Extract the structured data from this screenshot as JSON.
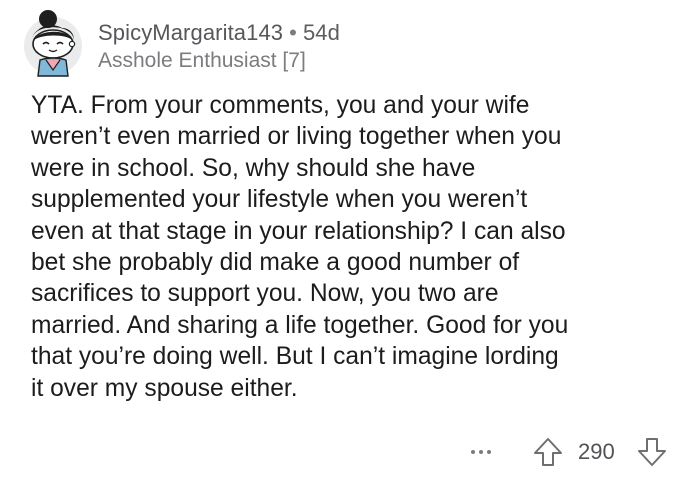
{
  "comment": {
    "username": "SpicyMargarita143",
    "separator": "•",
    "age": "54d",
    "flair": "Asshole Enthusiast [7]",
    "body": "YTA. From your comments, you and your wife\nweren’t even married or living together when you\nwere in school. So, why should she have\nsupplemented your lifestyle when you weren’t\neven at that stage in your relationship? I can also\nbet she probably did make a good number of\nsacrifices to support you. Now, you two are\nmarried. And sharing a life together. Good for you\nthat you’re doing well. But I can’t imagine lording\nit over my spouse either.",
    "score": "290"
  },
  "icons": {
    "avatar": "avatar-icon",
    "more": "more-options-icon",
    "upvote": "upvote-arrow-icon",
    "downvote": "downvote-arrow-icon"
  },
  "colors": {
    "text": "#1c1c1c",
    "meta": "#5b5d60",
    "icon": "#7c7c7c"
  }
}
